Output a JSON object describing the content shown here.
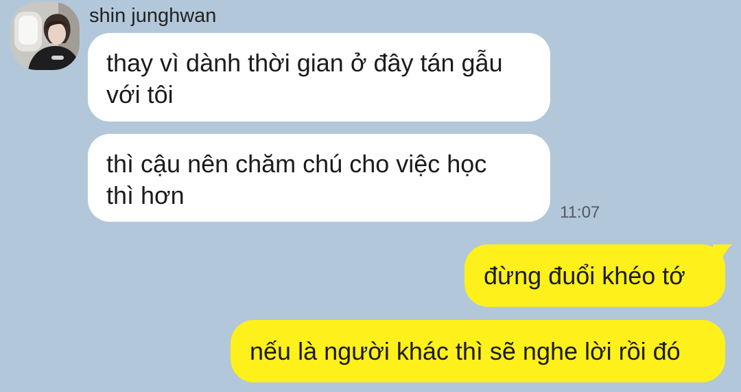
{
  "chat": {
    "sender": {
      "name": "shin junghwan",
      "avatar_icon": "profile-photo"
    },
    "incoming_messages": [
      {
        "line1": "thay vì dành thời gian ở đây tán gẫu",
        "line2": "với tôi"
      },
      {
        "line1": "thì cậu nên chăm chú cho việc học",
        "line2": "thì hơn"
      }
    ],
    "incoming_time": "11:07",
    "outgoing_messages": [
      {
        "text": "đừng đuổi khéo tớ"
      },
      {
        "text": "nếu là người khác thì sẽ nghe lời rồi đó"
      }
    ]
  },
  "colors": {
    "background": "#b2c7da",
    "incoming_bubble": "#ffffff",
    "outgoing_bubble": "#fef01b",
    "text": "#1b1b1b",
    "timestamp": "#4f5a63"
  }
}
